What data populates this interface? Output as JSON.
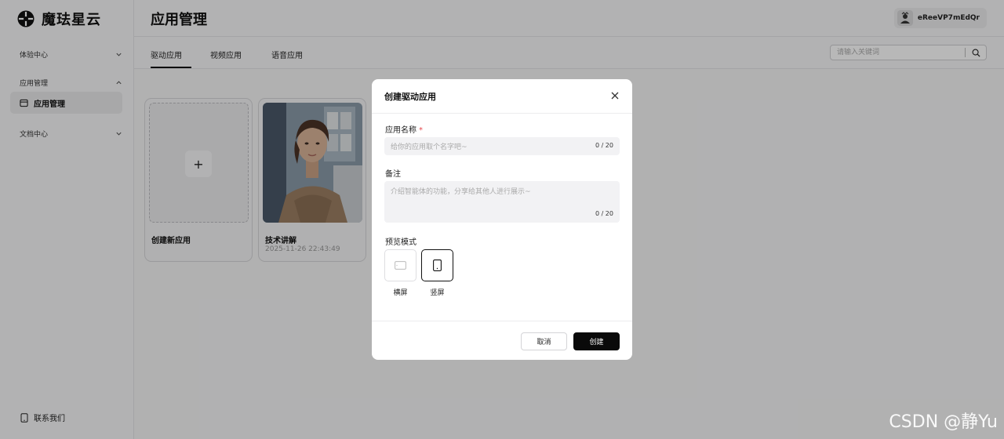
{
  "brand": {
    "name": "魔珐星云"
  },
  "sidebar": {
    "groups": [
      {
        "label": "体验中心"
      },
      {
        "label": "应用管理"
      },
      {
        "label": "文档中心"
      }
    ],
    "active_item": "应用管理",
    "contact": "联系我们"
  },
  "header": {
    "title": "应用管理",
    "username": "eReeVP7mEdQr"
  },
  "tabs": [
    {
      "label": "驱动应用",
      "active": true
    },
    {
      "label": "视频应用",
      "active": false
    },
    {
      "label": "语音应用",
      "active": false
    }
  ],
  "search": {
    "placeholder": "请输入关键词"
  },
  "cards": [
    {
      "title": "创建新应用",
      "plus": "+"
    },
    {
      "title": "技术讲解",
      "date": "2025-11-26 22:43:49"
    }
  ],
  "modal": {
    "title": "创建驱动应用",
    "name_label": "应用名称",
    "required_mark": "*",
    "name_placeholder": "给你的应用取个名字吧~",
    "name_counter": "0 / 20",
    "note_label": "备注",
    "note_placeholder": "介绍智能体的功能，分享给其他人进行展示~",
    "note_counter": "0 / 20",
    "mode_label": "预览模式",
    "modes": [
      {
        "label": "横屏",
        "selected": false
      },
      {
        "label": "竖屏",
        "selected": true
      }
    ],
    "cancel": "取消",
    "create": "创建"
  },
  "watermark": "CSDN @静Yu"
}
